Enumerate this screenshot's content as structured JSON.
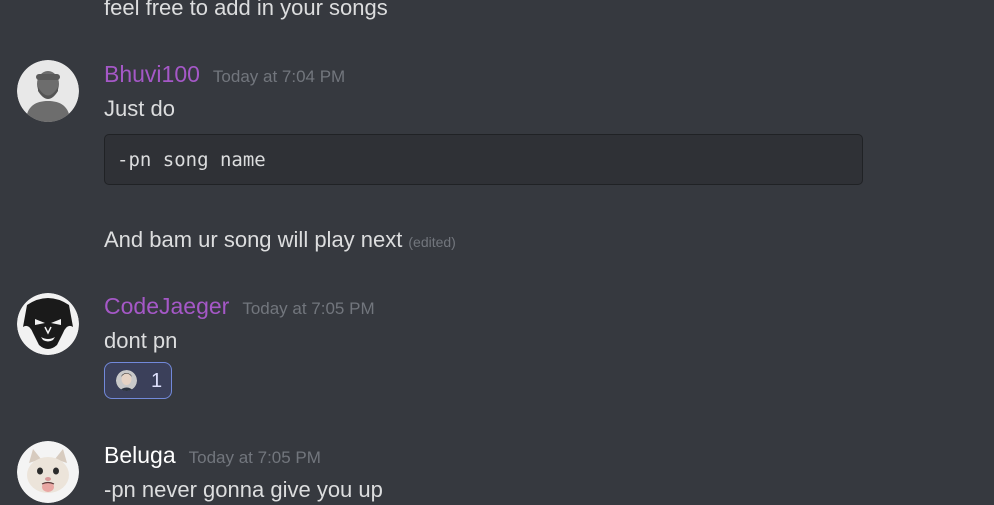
{
  "messages": [
    {
      "text": "feel free to add in your songs"
    },
    {
      "author": "Bhuvi100",
      "timestamp": "Today at 7:04 PM",
      "author_color": "#a558c7",
      "avatar_icon": "default-person-avatar",
      "lines": [
        "Just do",
        "And bam ur song will play next"
      ],
      "code": "-pn song name",
      "edited_label": "(edited)"
    },
    {
      "author": "CodeJaeger",
      "timestamp": "Today at 7:05 PM",
      "author_color": "#a558c7",
      "avatar_icon": "sketch-face-avatar",
      "text": "dont pn",
      "reaction": {
        "emoji_icon": "person-face-emoji",
        "count": "1"
      }
    },
    {
      "author": "Beluga",
      "timestamp": "Today at 7:05 PM",
      "author_color": "#ffffff",
      "avatar_icon": "cat-avatar",
      "text": "-pn never gonna give you up"
    }
  ],
  "colors": {
    "background": "#36393f",
    "code_background": "#2f3136",
    "timestamp": "#72767d",
    "reaction_border": "#7289da"
  }
}
